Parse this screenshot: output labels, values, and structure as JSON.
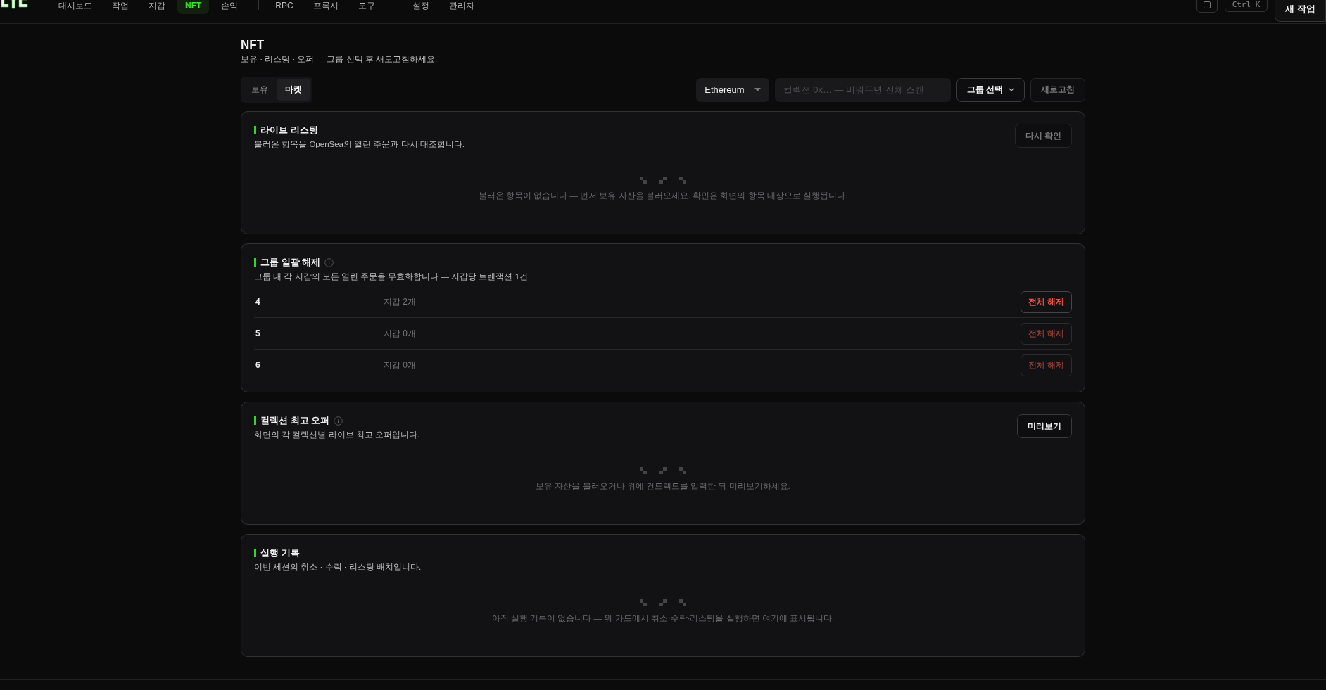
{
  "nav": {
    "groups": [
      [
        {
          "label": "대시보드",
          "selected": false
        },
        {
          "label": "작업",
          "selected": false
        },
        {
          "label": "지갑",
          "selected": false
        },
        {
          "label": "NFT",
          "selected": true
        },
        {
          "label": "손익",
          "selected": false
        }
      ],
      [
        {
          "label": "RPC",
          "selected": false
        },
        {
          "label": "프록시",
          "selected": false
        },
        {
          "label": "도구",
          "selected": false
        }
      ],
      [
        {
          "label": "설정",
          "selected": false
        },
        {
          "label": "관리자",
          "selected": false
        }
      ]
    ],
    "shortcut": "Ctrl K",
    "new_task": "새 작업"
  },
  "header": {
    "title": "NFT",
    "subtitle": "보유 · 리스팅 · 오퍼 — 그룹 선택 후 새로고침하세요."
  },
  "toolbar": {
    "tabs": [
      {
        "label": "보유",
        "selected": false
      },
      {
        "label": "마켓",
        "selected": true
      }
    ],
    "chain": "Ethereum",
    "collection": {
      "placeholder": "컬렉션 0x… — 비워두면 전체 스캔"
    },
    "group": "그룹 선택",
    "refresh": {
      "label": "새로고침",
      "disabled": true
    }
  },
  "cards": [
    {
      "kind": "empty",
      "title": "라이브 리스팅",
      "info": false,
      "description": "불러온 항목을 OpenSea의 열린 주문과 다시 대조합니다.",
      "action": {
        "label": "다시 확인",
        "disabled": true
      },
      "empty": "불러온 항목이 없습니다 — 먼저 보유 자산을 불러오세요. 확인은 화면의 항목 대상으로 실행됩니다."
    },
    {
      "kind": "groups",
      "title": "그룹 일괄 해제",
      "info": true,
      "description": "그룹 내 각 지갑의 모든 열린 주문을 무효화합니다 — 지갑당 트랜잭션 1건.",
      "rows": [
        {
          "name": "4",
          "wallets": "지갑 2개",
          "button": "전체 해제",
          "disabled": false
        },
        {
          "name": "5",
          "wallets": "지갑 0개",
          "button": "전체 해제",
          "disabled": true
        },
        {
          "name": "6",
          "wallets": "지갑 0개",
          "button": "전체 해제",
          "disabled": true
        }
      ]
    },
    {
      "kind": "empty",
      "title": "컬렉션 최고 오퍼",
      "info": true,
      "description": "화면의 각 컬렉션별 라이브 최고 오퍼입니다.",
      "action": {
        "label": "미리보기",
        "disabled": false
      },
      "empty": "보유 자산을 불러오거나 위에 컨트랙트를 입력한 뒤 미리보기하세요."
    },
    {
      "kind": "empty",
      "title": "실행 기록",
      "info": false,
      "description": "이번 세션의 취소 · 수락 · 리스팅 배치입니다.",
      "empty": "아직 실행 기록이 없습니다 — 위 카드에서 취소·수락·리스팅을 실행하면 여기에 표시됩니다."
    }
  ]
}
